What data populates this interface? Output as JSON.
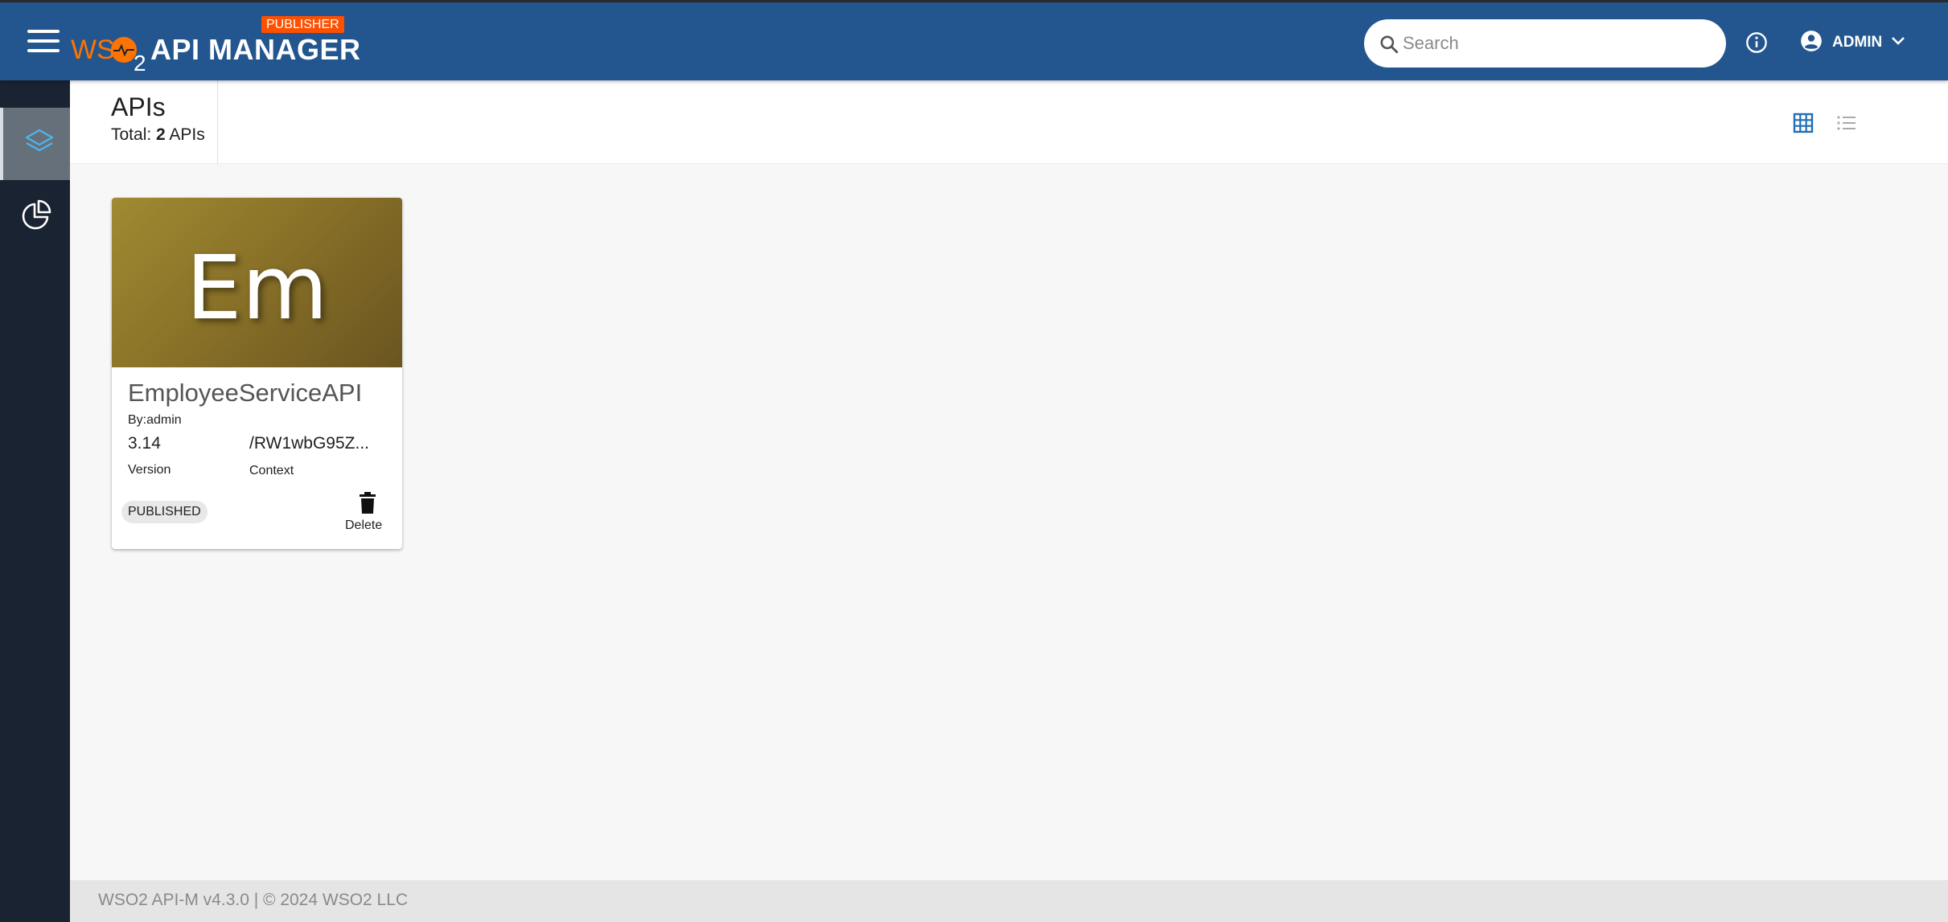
{
  "header": {
    "brand_prefix": "WSO",
    "brand_suffix": "2",
    "app_title": "API MANAGER",
    "badge": "PUBLISHER",
    "search_placeholder": "Search",
    "user_label": "ADMIN",
    "colors": {
      "bar": "#23568f",
      "brand_orange": "#ff7300",
      "badge": "#ff5000"
    }
  },
  "sidebar": {
    "items": [
      {
        "icon": "layers-icon",
        "active": true
      },
      {
        "icon": "pie-chart-icon",
        "active": false
      }
    ]
  },
  "page": {
    "title": "APIs",
    "total_prefix": "Total:",
    "total_count": "2",
    "total_suffix": "APIs",
    "view_modes": [
      "grid-icon",
      "list-icon"
    ],
    "active_view": "grid"
  },
  "api_cards": [
    {
      "thumbnail_text": "Em",
      "name": "EmployeeServiceAPI",
      "by": "By:admin",
      "version": "3.14",
      "version_label": "Version",
      "context": "/RW1wbG95Z...",
      "context_label": "Context",
      "status": "PUBLISHED",
      "delete_label": "Delete"
    }
  ],
  "footer": {
    "text": "WSO2 API-M v4.3.0 | © 2024 WSO2 LLC"
  }
}
